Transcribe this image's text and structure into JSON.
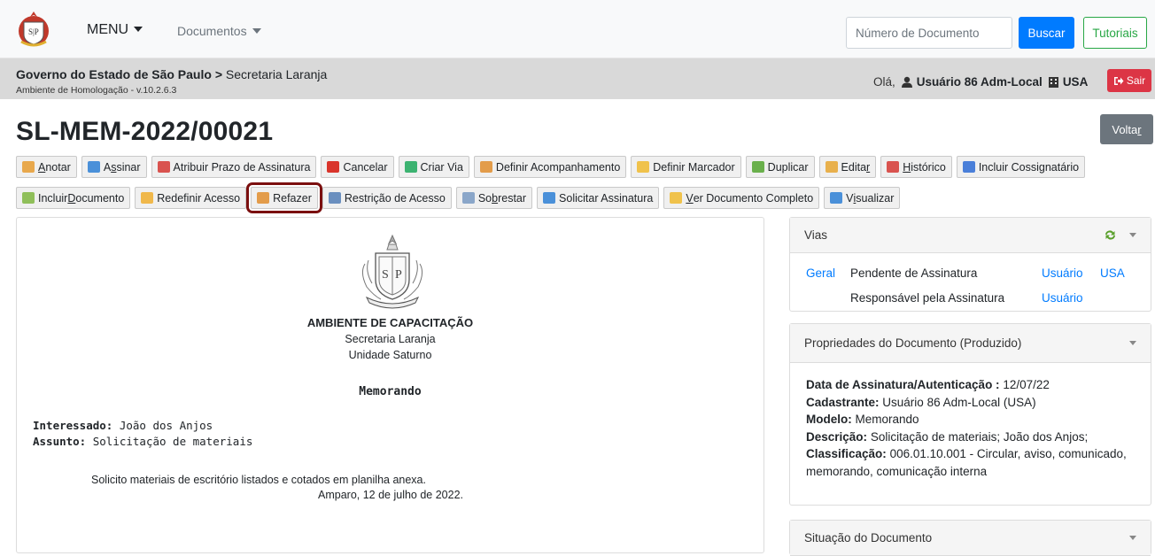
{
  "navbar": {
    "menu_label": "MENU",
    "docs_label": "Documentos",
    "search_placeholder": "Número de Documento",
    "search_button": "Buscar",
    "tutorials_button": "Tutoriais"
  },
  "subheader": {
    "breadcrumb_org": "Governo do Estado de São Paulo",
    "breadcrumb_sep": ">",
    "breadcrumb_unit": "Secretaria Laranja",
    "environment": "Ambiente de Homologação - v.10.2.6.3",
    "greeting": "Olá,",
    "user_name": "Usuário 86 Adm-Local",
    "user_unit": "USA",
    "logout_label": "Sair"
  },
  "title": "SL-MEM-2022/00021",
  "back_button": {
    "pre": "Volta",
    "accel": "r"
  },
  "toolbar_row1": [
    {
      "pre": "",
      "accel": "A",
      "post": "notar",
      "icon": "annotate-icon",
      "color": "#e8a84c"
    },
    {
      "pre": "A",
      "accel": "s",
      "post": "sinar",
      "icon": "sign-icon",
      "color": "#4a90d9"
    },
    {
      "pre": "Atribuir Prazo de Assinatura",
      "accel": "",
      "post": "",
      "icon": "calendar-icon",
      "color": "#d9534f"
    },
    {
      "pre": "Cancelar",
      "accel": "",
      "post": "",
      "icon": "cancel-icon",
      "color": "#d9342b"
    },
    {
      "pre": "Criar Via",
      "accel": "",
      "post": "",
      "icon": "add-circle-icon",
      "color": "#3cb371"
    },
    {
      "pre": "Definir Acompanhamento",
      "accel": "",
      "post": "",
      "icon": "user-track-icon",
      "color": "#e39c4a"
    },
    {
      "pre": "Definir Marcador",
      "accel": "",
      "post": "",
      "icon": "folder-tag-icon",
      "color": "#f0c24b"
    },
    {
      "pre": "Duplicar",
      "accel": "",
      "post": "",
      "icon": "duplicate-icon",
      "color": "#6ab04c"
    },
    {
      "pre": "Edita",
      "accel": "r",
      "post": "",
      "icon": "pencil-icon",
      "color": "#e8b04c"
    },
    {
      "pre": "",
      "accel": "H",
      "post": "istórico",
      "icon": "history-icon",
      "color": "#d9534f"
    },
    {
      "pre": "Incluir Cossignatário",
      "accel": "",
      "post": "",
      "icon": "cosigner-icon",
      "color": "#4a7fd9"
    }
  ],
  "toolbar_row2": [
    {
      "pre": "Incluir ",
      "accel": "D",
      "post": "ocumento",
      "icon": "new-document-icon",
      "color": "#8fbf5a"
    },
    {
      "pre": "Redefinir Acesso",
      "accel": "",
      "post": "",
      "icon": "shield-icon",
      "color": "#f0b84b"
    },
    {
      "pre": "Refazer",
      "accel": "",
      "post": "",
      "icon": "redo-icon",
      "color": "#e39c4a",
      "highlight": true
    },
    {
      "pre": "Restrição de Acesso",
      "accel": "",
      "post": "",
      "icon": "restrict-access-icon",
      "color": "#6a8fbf"
    },
    {
      "pre": "So",
      "accel": "b",
      "post": "restar",
      "icon": "hourglass-icon",
      "color": "#8aa6c9"
    },
    {
      "pre": "Solicitar Assinatura",
      "accel": "",
      "post": "",
      "icon": "request-sign-icon",
      "color": "#4a90d9"
    },
    {
      "pre": "",
      "accel": "V",
      "post": "er Documento Completo",
      "icon": "folder-icon",
      "color": "#f0c24b"
    },
    {
      "pre": "V",
      "accel": "i",
      "post": "sualizar",
      "icon": "eye-icon",
      "color": "#4a90d9"
    }
  ],
  "document": {
    "heading": "AMBIENTE DE CAPACITAÇÃO",
    "secretaria": "Secretaria Laranja",
    "unidade": "Unidade Saturno",
    "type": "Memorando",
    "interessado_label": "Interessado:",
    "interessado_value": "João dos Anjos",
    "assunto_label": "Assunto:",
    "assunto_value": "Solicitação de materiais",
    "body": "Solicito materiais de escritório listados e cotados em planilha anexa.",
    "place_date": "Amparo, 12 de julho de 2022."
  },
  "vias": {
    "header": "Vias",
    "row1": {
      "via": "Geral",
      "status": "Pendente de Assinatura",
      "user": "Usuário",
      "unit": "USA"
    },
    "row2": {
      "status": "Responsável pela Assinatura",
      "user": "Usuário"
    }
  },
  "properties": {
    "header": "Propriedades do Documento (Produzido)",
    "date_label": "Data de Assinatura/Autenticação :",
    "date_value": "12/07/22",
    "creator_label": "Cadastrante:",
    "creator_value": "Usuário 86 Adm-Local (USA)",
    "model_label": "Modelo:",
    "model_value": "Memorando",
    "desc_label": "Descrição:",
    "desc_value": "Solicitação de materiais; João dos Anjos;",
    "class_label": "Classificação:",
    "class_value": "006.01.10.001 - Circular, aviso, comunicado, memorando, comunicação interna"
  },
  "situacao": {
    "header": "Situação do Documento"
  }
}
